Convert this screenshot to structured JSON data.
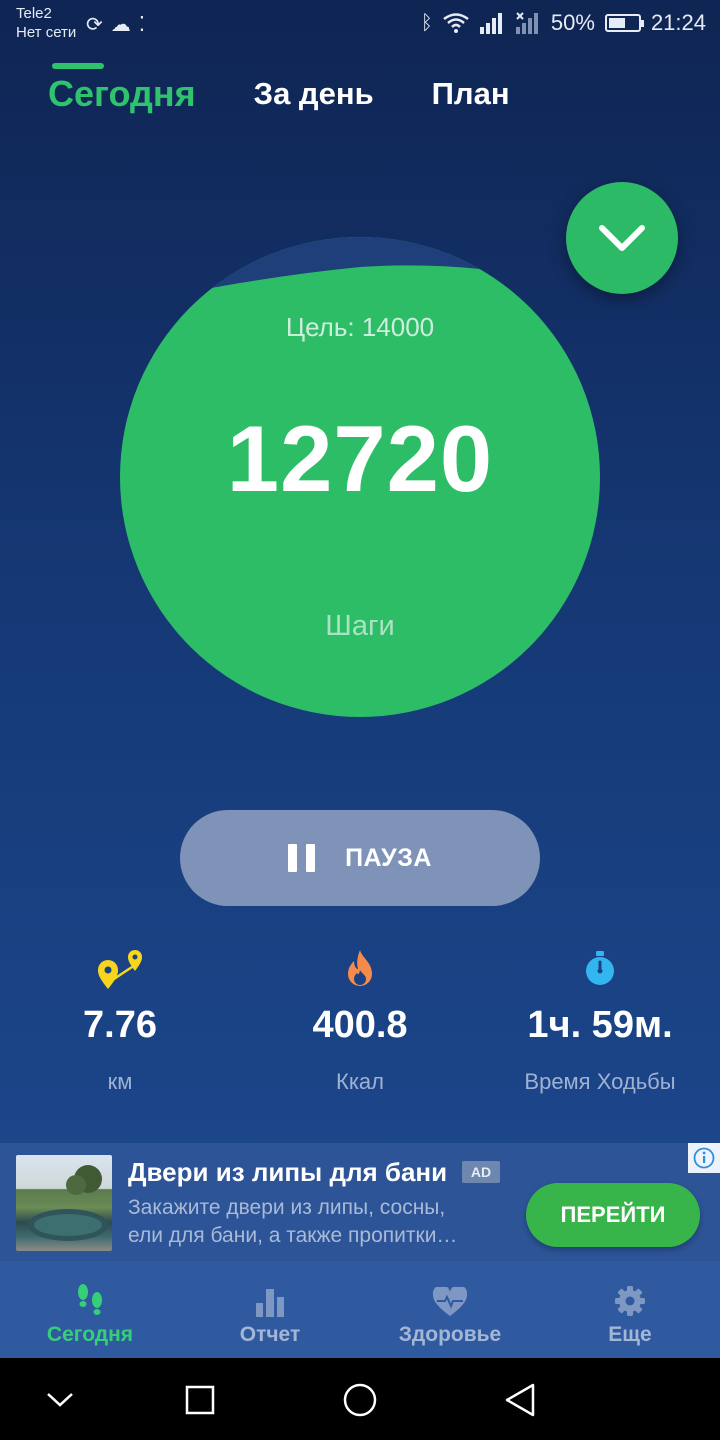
{
  "status_bar": {
    "carrier": "Tele2",
    "network": "Нет сети",
    "battery": "50%",
    "time": "21:24"
  },
  "tabs": [
    {
      "label": "Сегодня",
      "active": true
    },
    {
      "label": "За день",
      "active": false
    },
    {
      "label": "План",
      "active": false
    }
  ],
  "progress": {
    "goal_label": "Цель: 14000",
    "steps": "12720",
    "steps_label": "Шаги",
    "fraction": 0.909
  },
  "pause_button": {
    "label": "ПАУЗА"
  },
  "stats": [
    {
      "value": "7.76",
      "label": "км",
      "icon": "distance-pins-icon",
      "color": "#f7d51d"
    },
    {
      "value": "400.8",
      "label": "Ккал",
      "icon": "flame-icon",
      "color": "#f58a4b"
    },
    {
      "value": "1ч. 59м.",
      "label": "Время Ходьбы",
      "icon": "stopwatch-icon",
      "color": "#33b5f0"
    }
  ],
  "ad": {
    "title": "Двери из липы для бани",
    "badge": "AD",
    "description_line1": "Закажите двери из липы, сосны,",
    "description_line2": "ели для бани, а также пропитки…",
    "cta": "ПЕРЕЙТИ"
  },
  "bottom_nav": [
    {
      "label": "Сегодня",
      "icon": "footsteps-icon",
      "active": true
    },
    {
      "label": "Отчет",
      "icon": "bar-chart-icon",
      "active": false
    },
    {
      "label": "Здоровье",
      "icon": "heart-pulse-icon",
      "active": false
    },
    {
      "label": "Еще",
      "icon": "gear-icon",
      "active": false
    }
  ],
  "colors": {
    "accent": "#2fc36d",
    "circle": "#2ebd67",
    "background_top": "#0f2553",
    "background_bottom": "#1f4d94"
  }
}
